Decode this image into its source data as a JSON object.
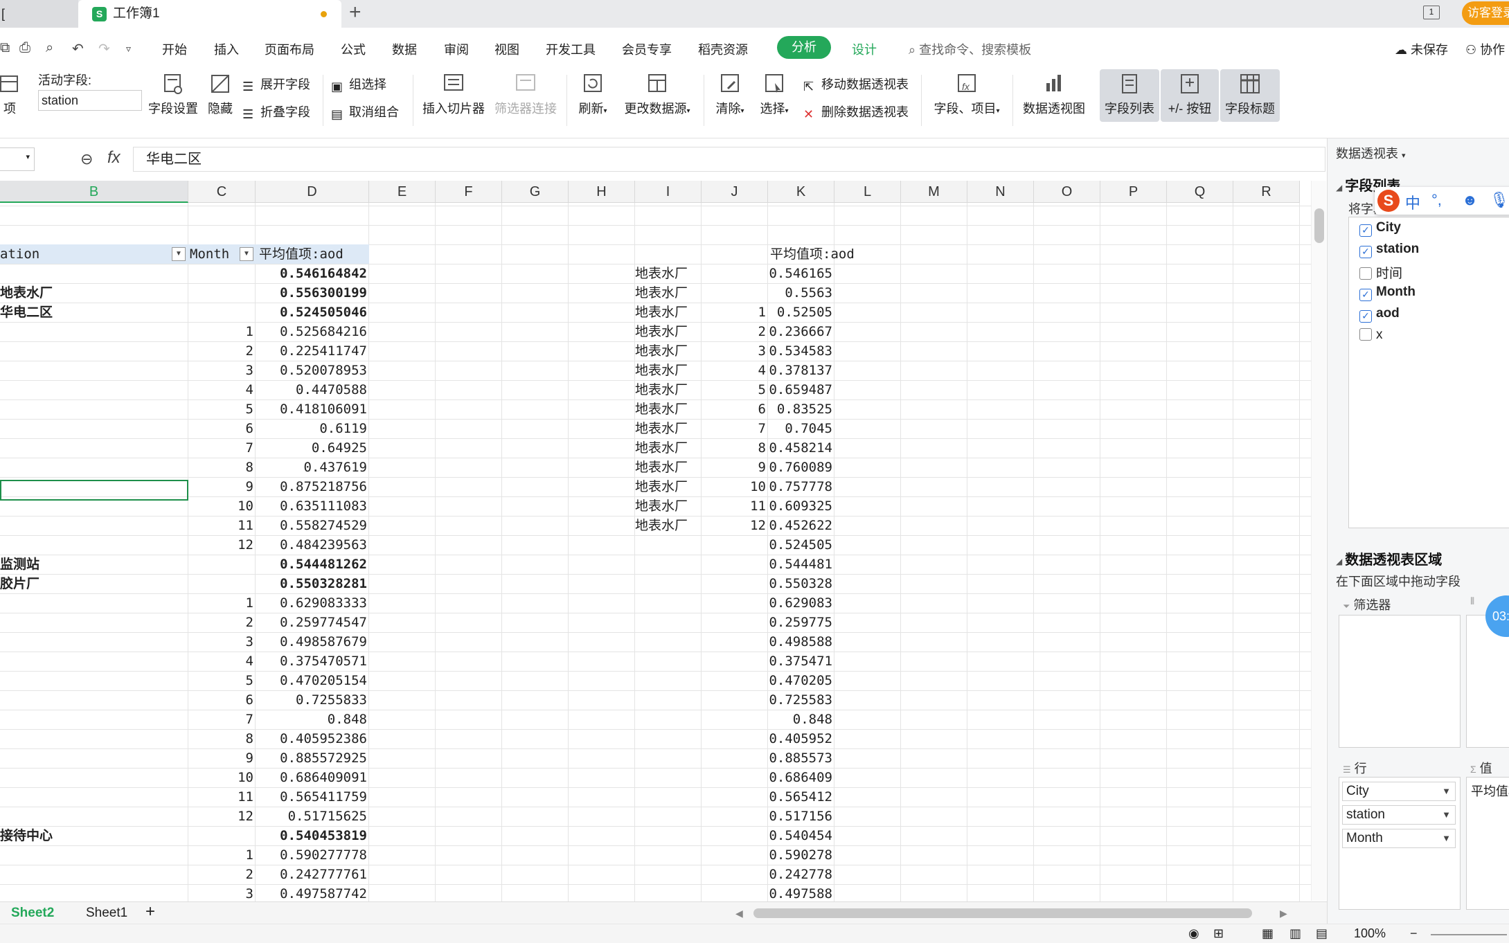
{
  "tabbar": {
    "prev_tab": "[",
    "doc_title": "工作簿1",
    "logo": "S",
    "new_tab": "+",
    "window_icon": "1",
    "visitor_label": "访客登录"
  },
  "menu": {
    "items": [
      "开始",
      "插入",
      "页面布局",
      "公式",
      "数据",
      "审阅",
      "视图",
      "开发工具",
      "会员专享",
      "稻壳资源"
    ],
    "analyze": "分析",
    "design": "设计",
    "search_placeholder": "查找命令、搜索模板",
    "unsaved": "未保存",
    "collab": "协作"
  },
  "ribbon": {
    "active_field_label": "活动字段:",
    "active_field_value": "station",
    "left_cut": "项",
    "field_settings": "字段设置",
    "hide": "隐藏",
    "expand_field": "展开字段",
    "collapse_field": "折叠字段",
    "group_select": "组选择",
    "ungroup": "取消组合",
    "insert_slicer": "插入切片器",
    "filter_connect": "筛选器连接",
    "refresh": "刷新",
    "change_source": "更改数据源",
    "clear": "清除",
    "select": "选择",
    "move_pivot": "移动数据透视表",
    "delete_pivot": "删除数据透视表",
    "fields_items": "字段、项目",
    "pivot_chart": "数据透视图",
    "field_list": "字段列表",
    "plus_minus": "+/- 按钮",
    "field_header": "字段标题"
  },
  "formula": {
    "value": "华电二区",
    "fx": "fx"
  },
  "columns": [
    "B",
    "C",
    "D",
    "E",
    "F",
    "G",
    "H",
    "I",
    "J",
    "K",
    "L",
    "M",
    "N",
    "O",
    "P",
    "Q",
    "R"
  ],
  "pivot": {
    "h_station": "ation",
    "h_month": "Month",
    "h_value": "平均值项:aod",
    "k_header": "平均值项:aod"
  },
  "rows": [
    {
      "b": "",
      "c": "",
      "d": "0.546164842",
      "bold": true,
      "i": "地表水厂",
      "j": "",
      "k": "0.546165"
    },
    {
      "b": "地表水厂",
      "c": "",
      "d": "0.556300199",
      "bold": true,
      "i": "地表水厂",
      "j": "",
      "k": "0.5563"
    },
    {
      "b": "华电二区",
      "c": "",
      "d": "0.524505046",
      "bold": true,
      "i": "地表水厂",
      "j": "1",
      "k": "0.52505"
    },
    {
      "b": "",
      "c": "1",
      "d": "0.525684216",
      "bold": false,
      "i": "地表水厂",
      "j": "2",
      "k": "0.236667"
    },
    {
      "b": "",
      "c": "2",
      "d": "0.225411747",
      "bold": false,
      "i": "地表水厂",
      "j": "3",
      "k": "0.534583"
    },
    {
      "b": "",
      "c": "3",
      "d": "0.520078953",
      "bold": false,
      "i": "地表水厂",
      "j": "4",
      "k": "0.378137"
    },
    {
      "b": "",
      "c": "4",
      "d": "0.4470588",
      "bold": false,
      "i": "地表水厂",
      "j": "5",
      "k": "0.659487"
    },
    {
      "b": "",
      "c": "5",
      "d": "0.418106091",
      "bold": false,
      "i": "地表水厂",
      "j": "6",
      "k": "0.83525"
    },
    {
      "b": "",
      "c": "6",
      "d": "0.6119",
      "bold": false,
      "i": "地表水厂",
      "j": "7",
      "k": "0.7045"
    },
    {
      "b": "",
      "c": "7",
      "d": "0.64925",
      "bold": false,
      "i": "地表水厂",
      "j": "8",
      "k": "0.458214"
    },
    {
      "b": "",
      "c": "8",
      "d": "0.437619",
      "bold": false,
      "i": "地表水厂",
      "j": "9",
      "k": "0.760089"
    },
    {
      "b": "",
      "c": "9",
      "d": "0.875218756",
      "bold": false,
      "i": "地表水厂",
      "j": "10",
      "k": "0.757778"
    },
    {
      "b": "",
      "c": "10",
      "d": "0.635111083",
      "bold": false,
      "i": "地表水厂",
      "j": "11",
      "k": "0.609325"
    },
    {
      "b": "",
      "c": "11",
      "d": "0.558274529",
      "bold": false,
      "i": "地表水厂",
      "j": "12",
      "k": "0.452622"
    },
    {
      "b": "",
      "c": "12",
      "d": "0.484239563",
      "bold": false,
      "i": "",
      "j": "",
      "k": "0.524505"
    },
    {
      "b": "监测站",
      "c": "",
      "d": "0.544481262",
      "bold": true,
      "i": "",
      "j": "",
      "k": "0.544481"
    },
    {
      "b": "胶片厂",
      "c": "",
      "d": "0.550328281",
      "bold": true,
      "i": "",
      "j": "",
      "k": "0.550328"
    },
    {
      "b": "",
      "c": "1",
      "d": "0.629083333",
      "bold": false,
      "i": "",
      "j": "",
      "k": "0.629083"
    },
    {
      "b": "",
      "c": "2",
      "d": "0.259774547",
      "bold": false,
      "i": "",
      "j": "",
      "k": "0.259775"
    },
    {
      "b": "",
      "c": "3",
      "d": "0.498587679",
      "bold": false,
      "i": "",
      "j": "",
      "k": "0.498588"
    },
    {
      "b": "",
      "c": "4",
      "d": "0.375470571",
      "bold": false,
      "i": "",
      "j": "",
      "k": "0.375471"
    },
    {
      "b": "",
      "c": "5",
      "d": "0.470205154",
      "bold": false,
      "i": "",
      "j": "",
      "k": "0.470205"
    },
    {
      "b": "",
      "c": "6",
      "d": "0.7255833",
      "bold": false,
      "i": "",
      "j": "",
      "k": "0.725583"
    },
    {
      "b": "",
      "c": "7",
      "d": "0.848",
      "bold": false,
      "i": "",
      "j": "",
      "k": "0.848"
    },
    {
      "b": "",
      "c": "8",
      "d": "0.405952386",
      "bold": false,
      "i": "",
      "j": "",
      "k": "0.405952"
    },
    {
      "b": "",
      "c": "9",
      "d": "0.885572925",
      "bold": false,
      "i": "",
      "j": "",
      "k": "0.885573"
    },
    {
      "b": "",
      "c": "10",
      "d": "0.686409091",
      "bold": false,
      "i": "",
      "j": "",
      "k": "0.686409"
    },
    {
      "b": "",
      "c": "11",
      "d": "0.565411759",
      "bold": false,
      "i": "",
      "j": "",
      "k": "0.565412"
    },
    {
      "b": "",
      "c": "12",
      "d": "0.51715625",
      "bold": false,
      "i": "",
      "j": "",
      "k": "0.517156"
    },
    {
      "b": "接待中心",
      "c": "",
      "d": "0.540453819",
      "bold": true,
      "i": "",
      "j": "",
      "k": "0.540454"
    },
    {
      "b": "",
      "c": "1",
      "d": "0.590277778",
      "bold": false,
      "i": "",
      "j": "",
      "k": "0.590278"
    },
    {
      "b": "",
      "c": "2",
      "d": "0.242777761",
      "bold": false,
      "i": "",
      "j": "",
      "k": "0.242778"
    },
    {
      "b": "",
      "c": "3",
      "d": "0.497587742",
      "bold": false,
      "i": "",
      "j": "",
      "k": "0.497588"
    }
  ],
  "sheets": {
    "active": "Sheet2",
    "other": "Sheet1",
    "add": "+"
  },
  "status": {
    "zoom": "100%"
  },
  "pane": {
    "title": "数据透视表",
    "field_list_title": "字段列表",
    "fields_hint": "将字段",
    "fields": [
      {
        "name": "City",
        "checked": true
      },
      {
        "name": "station",
        "checked": true
      },
      {
        "name": "时间",
        "checked": false
      },
      {
        "name": "Month",
        "checked": true
      },
      {
        "name": "aod",
        "checked": true
      },
      {
        "name": "x",
        "checked": false
      }
    ],
    "areas_title": "数据透视表区域",
    "areas_hint": "在下面区域中拖动字段",
    "filter_label": "筛选器",
    "rows_label": "行",
    "values_label": "值",
    "row_fields": [
      "City",
      "station",
      "Month"
    ],
    "value_field": "平均值项",
    "ime": {
      "logo": "S",
      "lang": "中",
      "punct": "°,"
    },
    "timer": "03:"
  }
}
